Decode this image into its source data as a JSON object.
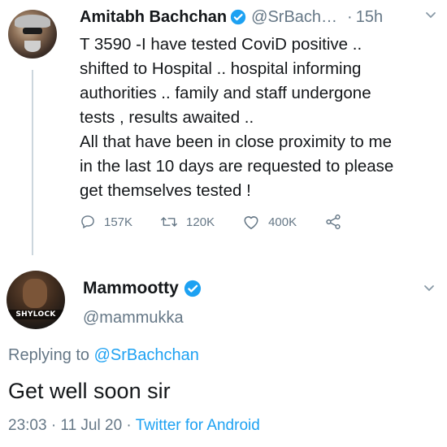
{
  "tweet1": {
    "author_name": "Amitabh Bachchan",
    "handle": "@SrBach…",
    "dot": "·",
    "time": "15h",
    "lines": [
      "T 3590 -I have tested CoviD positive ..",
      "shifted to Hospital  .. hospital informing",
      "authorities .. family and staff undergone",
      "tests , results awaited ..",
      "All that have been in close proximity to me",
      "in the last 10 days are requested to please",
      "get themselves tested !"
    ],
    "replies": "157K",
    "retweets": "120K",
    "likes": "400K"
  },
  "tweet2": {
    "author_name": "Mammootty",
    "handle": "@mammukka",
    "avatar_label": "SHYLOCK",
    "replying_prefix": "Replying to",
    "replying_mention": "@SrBachchan",
    "text": "Get well soon sir",
    "timestamp": "23:03 · 11 Jul 20 ·",
    "client": "Twitter for Android"
  },
  "icons": {
    "verified": "verified-badge-icon",
    "chevron": "chevron-down-icon",
    "reply": "reply-icon",
    "retweet": "retweet-icon",
    "like": "heart-icon",
    "share": "share-icon"
  },
  "colors": {
    "accent": "#1da1f2",
    "muted": "#657786",
    "text": "#14171a",
    "thread_line": "#ccd6dd"
  }
}
